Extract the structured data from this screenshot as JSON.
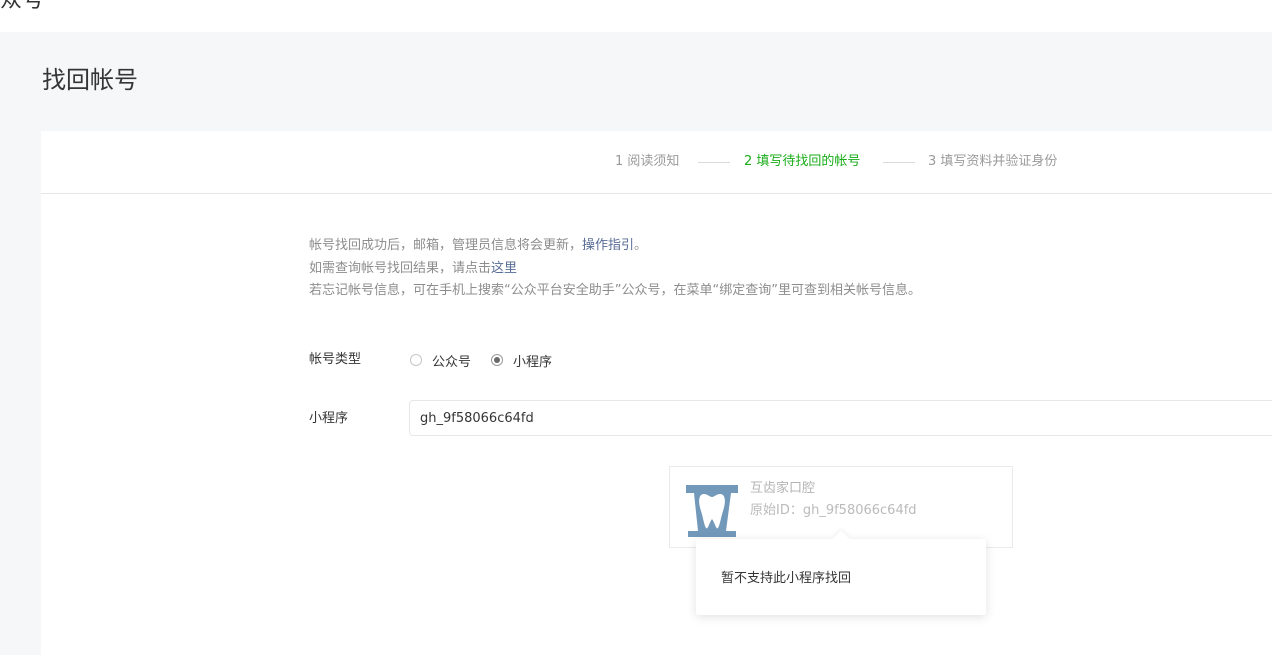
{
  "topbar": {
    "title": "众号"
  },
  "page": {
    "title": "找回帐号"
  },
  "steps": [
    {
      "label": "1 阅读须知",
      "active": false
    },
    {
      "label": "2 填写待找回的帐号",
      "active": true
    },
    {
      "label": "3 填写资料并验证身份",
      "active": false
    }
  ],
  "notice": {
    "line1_text": "帐号找回成功后，邮箱，管理员信息将会更新，",
    "line1_link": "操作指引",
    "line1_end": "。",
    "line2_text": "如需查询帐号找回结果，请点击",
    "line2_link": "这里",
    "line3_text": "若忘记帐号信息，可在手机上搜索“公众平台安全助手”公众号，在菜单“绑定查询”里可查到相关帐号信息。"
  },
  "form": {
    "account_type_label": "帐号类型",
    "options": [
      {
        "label": "公众号",
        "checked": false
      },
      {
        "label": "小程序",
        "checked": true
      }
    ],
    "miniprogram_label": "小程序",
    "miniprogram_value": "gh_9f58066c64fd"
  },
  "result": {
    "name": "互齿家口腔",
    "id_text": "原始ID：gh_9f58066c64fd",
    "logo_icon": "tooth-logo-icon",
    "logo_color": "#3a6f9f"
  },
  "tooltip": {
    "text": "暂不支持此小程序找回"
  },
  "colors": {
    "accent_green": "#1aad19",
    "link_blue": "#576b95",
    "page_bg": "#f6f7f9"
  }
}
